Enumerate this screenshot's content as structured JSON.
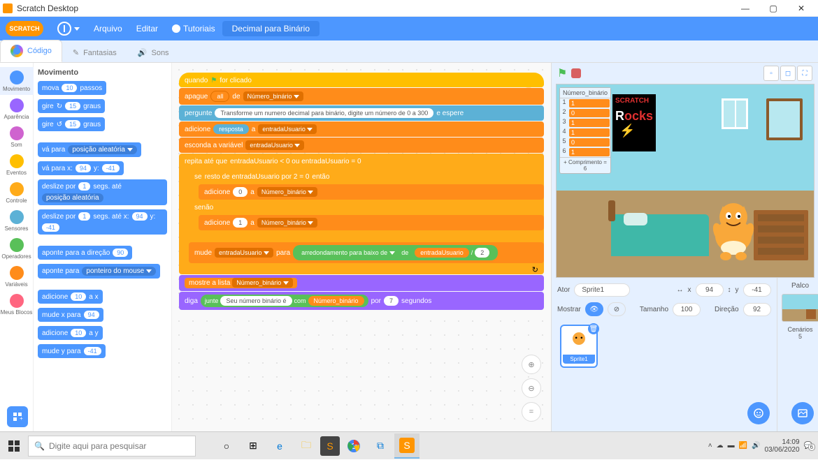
{
  "window": {
    "title": "Scratch Desktop"
  },
  "menu": {
    "file": "Arquivo",
    "edit": "Editar",
    "tutorials": "Tutoriais",
    "project": "Decimal para Binário"
  },
  "tabs": {
    "code": "Código",
    "costumes": "Fantasias",
    "sounds": "Sons"
  },
  "categories": [
    {
      "name": "Movimento",
      "color": "#4c97ff",
      "sel": true
    },
    {
      "name": "Aparência",
      "color": "#9966ff"
    },
    {
      "name": "Som",
      "color": "#cf63cf"
    },
    {
      "name": "Eventos",
      "color": "#ffbf00"
    },
    {
      "name": "Controle",
      "color": "#ffab19"
    },
    {
      "name": "Sensores",
      "color": "#5cb1d6"
    },
    {
      "name": "Operadores",
      "color": "#59c059"
    },
    {
      "name": "Variáveis",
      "color": "#ff8c1a"
    },
    {
      "name": "Meus Blocos",
      "color": "#ff6680"
    }
  ],
  "palette": {
    "heading": "Movimento",
    "move": {
      "a": "mova",
      "v": "10",
      "b": "passos"
    },
    "turn_cw": {
      "a": "gire",
      "icon": "↻",
      "v": "15",
      "b": "graus"
    },
    "turn_ccw": {
      "a": "gire",
      "icon": "↺",
      "v": "15",
      "b": "graus"
    },
    "goto": {
      "a": "vá para",
      "dd": "posição aleatória"
    },
    "gotoxy": {
      "a": "vá para x:",
      "x": "94",
      "b": "y:",
      "y": "-41"
    },
    "glide": {
      "a": "deslize por",
      "s": "1",
      "b": "segs. até",
      "dd": "posição aleatória"
    },
    "glidexy": {
      "a": "deslize por",
      "s": "1",
      "b": "segs. até x:",
      "x": "94",
      "c": "y:",
      "y": "-41"
    },
    "point": {
      "a": "aponte para a direção",
      "v": "90"
    },
    "pointto": {
      "a": "aponte para",
      "dd": "ponteiro do mouse"
    },
    "addx": {
      "a": "adicione",
      "v": "10",
      "b": "a x"
    },
    "setx": {
      "a": "mude x para",
      "v": "94"
    },
    "addy": {
      "a": "adicione",
      "v": "10",
      "b": "a y"
    },
    "sety": {
      "a": "mude y para",
      "v": "-41"
    }
  },
  "script": {
    "hat": "quando",
    "hat_flag": "⚑",
    "hat_b": "for clicado",
    "del": {
      "a": "apague",
      "v": "all",
      "b": "de",
      "list": "Número_binário"
    },
    "ask": {
      "a": "pergunte",
      "q": "Transforme um numero decimal para binário, digite um número de 0 a 300",
      "b": "e espere"
    },
    "add_ans": {
      "a": "adicione",
      "r": "resposta",
      "b": "a",
      "v": "entradaUsuario"
    },
    "hide": {
      "a": "esconda a variável",
      "v": "entradaUsuario"
    },
    "repeat": {
      "a": "repita até que",
      "v1": "entradaUsuario",
      "op1": "<",
      "n1": "0",
      "or": "ou",
      "v2": "entradaUsuario",
      "op2": "=",
      "n2": "0"
    },
    "if": {
      "a": "se",
      "mod_a": "resto de",
      "v": "entradaUsuario",
      "mod_b": "por",
      "n": "2",
      "eq": "=",
      "r": "0",
      "then": "então"
    },
    "add0": {
      "a": "adicione",
      "v": "0",
      "b": "a",
      "list": "Número_binário"
    },
    "else": "senão",
    "add1": {
      "a": "adicione",
      "v": "1",
      "b": "a",
      "list": "Número_binário"
    },
    "set": {
      "a": "mude",
      "var": "entradaUsuario",
      "b": "para",
      "floor": "arredondamento para baixo de",
      "c": "de",
      "v2": "entradaUsuario",
      "d": "/",
      "n": "2"
    },
    "show": {
      "a": "mostre a lista",
      "list": "Número_binário"
    },
    "say": {
      "a": "diga",
      "join": "junte",
      "t": "Seu número binário é",
      "with": "com",
      "list": "Número_binário",
      "for": "por",
      "n": "7",
      "sec": "segundos"
    }
  },
  "monitor": {
    "title": "Número_binário",
    "rows": [
      {
        "i": "1",
        "v": "1"
      },
      {
        "i": "2",
        "v": "0"
      },
      {
        "i": "3",
        "v": "1"
      },
      {
        "i": "4",
        "v": "1"
      },
      {
        "i": "5",
        "v": "0"
      },
      {
        "i": "6",
        "v": "1"
      }
    ],
    "footer": "+ Comprimento = 6"
  },
  "poster": {
    "l1": "SCRATCH",
    "l2": "R",
    "l3": "ocks"
  },
  "sprite": {
    "ator": "Ator",
    "name": "Sprite1",
    "xl": "x",
    "x": "94",
    "yl": "y",
    "y": "-41",
    "mostrar": "Mostrar",
    "tamanho": "Tamanho",
    "size": "100",
    "direcao": "Direção",
    "dir": "92",
    "card": "Sprite1"
  },
  "stagecol": {
    "palco": "Palco",
    "cenarios": "Cenários",
    "n": "5"
  },
  "taskbar": {
    "search": "Digite aqui para pesquisar",
    "time": "14:09",
    "date": "03/06/2020",
    "notif": "6"
  }
}
